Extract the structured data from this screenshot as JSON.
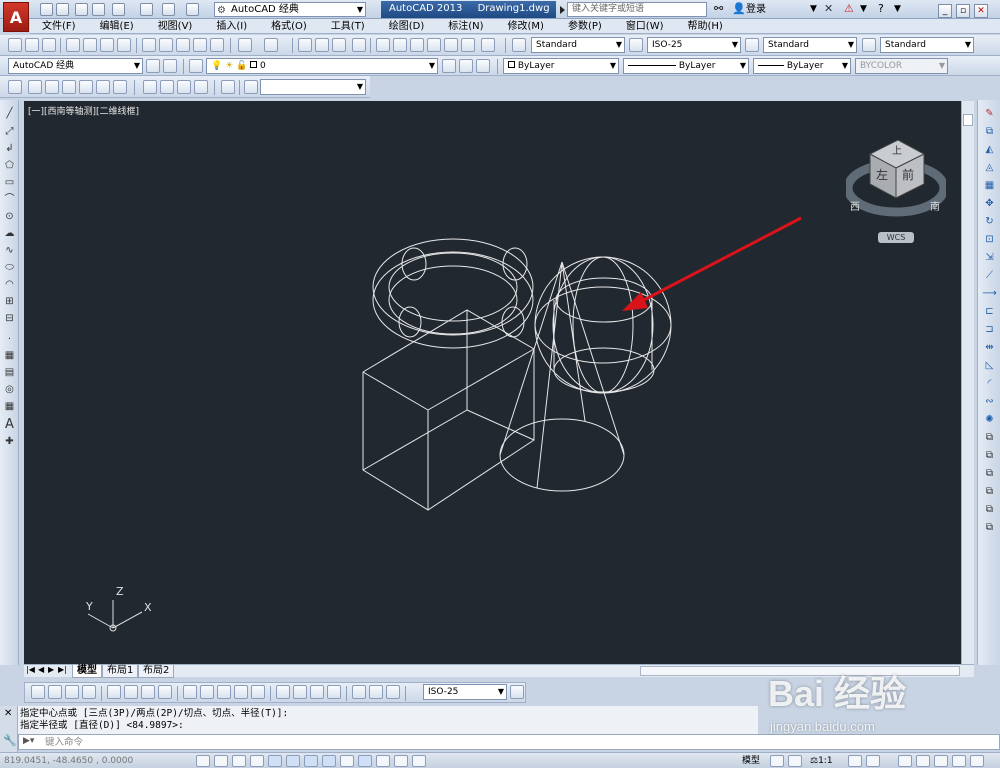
{
  "title_bar": {
    "workspace": "AutoCAD 经典",
    "app_name": "AutoCAD 2013",
    "file_name": "Drawing1.dwg",
    "search_placeholder": "键入关键字或短语",
    "login_label": "登录"
  },
  "menu": [
    "文件(F)",
    "编辑(E)",
    "视图(V)",
    "插入(I)",
    "格式(O)",
    "工具(T)",
    "绘图(D)",
    "标注(N)",
    "修改(M)",
    "参数(P)",
    "窗口(W)",
    "帮助(H)"
  ],
  "styles_toolbar": {
    "text_style": "Standard",
    "dim_style": "ISO-25",
    "table_style": "Standard",
    "multileader_style": "Standard"
  },
  "workspace_toolbar": {
    "workspace": "AutoCAD 经典"
  },
  "layers_toolbar": {
    "layer": "0"
  },
  "properties_toolbar": {
    "color": "ByLayer",
    "linetype": "ByLayer",
    "lineweight": "ByLayer",
    "plot_style": "BYCOLOR"
  },
  "viewport": {
    "label": "[一][西南等轴测][二维线框]",
    "viewcube": {
      "top": "上",
      "left": "左",
      "front": "前",
      "compass_w": "西",
      "compass_s": "南",
      "wcs": "WCS"
    },
    "ucs": {
      "x": "X",
      "y": "Y",
      "z": "Z"
    }
  },
  "layout_tabs": [
    "模型",
    "布局1",
    "布局2"
  ],
  "dim_toolbar": {
    "dim_style": "ISO-25"
  },
  "command": {
    "line1": "指定中心点或 [三点(3P)/两点(2P)/切点、切点、半径(T)]:",
    "line2": "指定半径或 [直径(D)] <84.9897>:",
    "input_placeholder": "键入命令"
  },
  "status": {
    "coords": "819.0451,  -48.4650 , 0.0000",
    "model_label": "模型",
    "scale": "1:1"
  },
  "watermark": {
    "brand": "Bai  经验",
    "url": "jingyan.baidu.com"
  },
  "annotation_color": "#d8141a"
}
